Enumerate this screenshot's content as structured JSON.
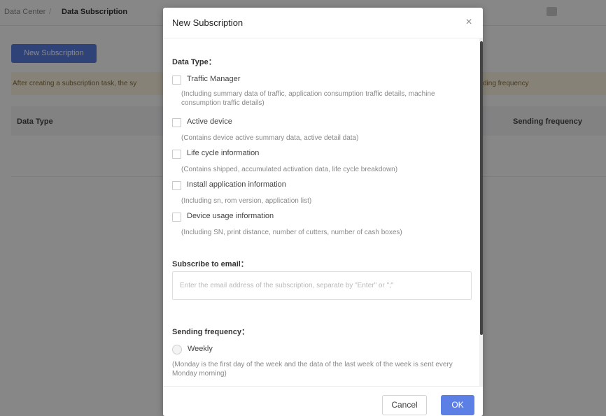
{
  "background": {
    "breadcrumb": {
      "parent": "Data Center",
      "separator": "/",
      "current": "Data Subscription"
    },
    "new_button_label": "New Subscription",
    "tip_text": "After creating a subscription task, the sy",
    "tip_text_end": "ding frequency",
    "table": {
      "col_data_type": "Data Type",
      "col_frequency": "Sending frequency"
    }
  },
  "modal": {
    "title": "New Subscription",
    "close_icon": "×",
    "data_type": {
      "title": "Data Type：",
      "options": [
        {
          "label": "Traffic Manager",
          "checked": false,
          "description": "(Including summary data of traffic, application consumption traffic details, machine consumption traffic details)"
        },
        {
          "label": "Active device",
          "checked": false,
          "description": "(Contains device active summary data, active detail data)"
        },
        {
          "label": "Life cycle information",
          "checked": false,
          "description": "(Contains shipped, accumulated activation data, life cycle breakdown)"
        },
        {
          "label": "Install application information",
          "checked": false,
          "description": "(Including sn, rom version, application list)"
        },
        {
          "label": "Device usage information",
          "checked": false,
          "description": "(Including SN, print distance, number of cutters, number of cash boxes)"
        }
      ]
    },
    "email": {
      "title": "Subscribe to email：",
      "value": "",
      "placeholder": "Enter the email address of the subscription, separate by \"Enter\" or \";\""
    },
    "frequency": {
      "title": "Sending frequency：",
      "options": [
        {
          "label": "Weekly",
          "selected": false,
          "description": "(Monday is the first day of the week and the data of the last week of the week is sent every Monday morning)"
        }
      ]
    },
    "footer": {
      "cancel_label": "Cancel",
      "ok_label": "OK"
    }
  },
  "colors": {
    "primary": "#5b7fe5",
    "overlay": "rgba(0,0,0,0.47)",
    "tip_background": "#fdf6e3"
  },
  "icons": {
    "close": "close-icon"
  }
}
